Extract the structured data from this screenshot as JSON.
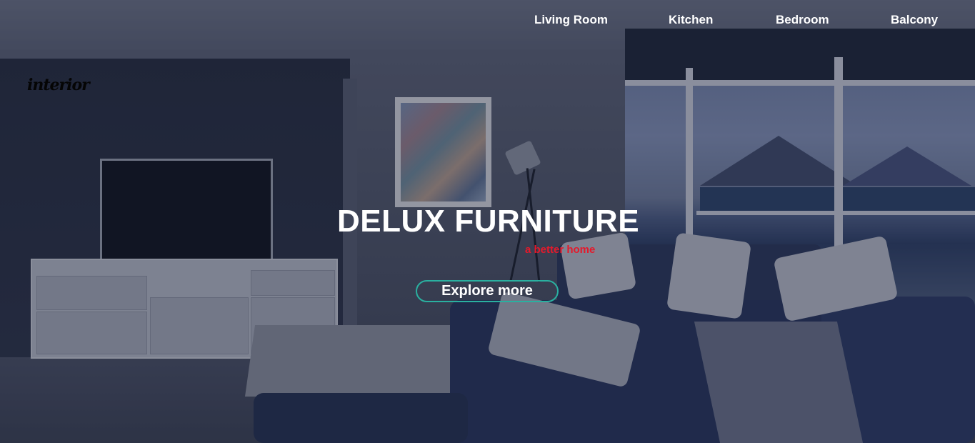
{
  "nav": {
    "items": [
      {
        "label": "Living Room"
      },
      {
        "label": "Kitchen"
      },
      {
        "label": "Bedroom"
      },
      {
        "label": "Balcony"
      }
    ]
  },
  "brand": {
    "logo_text": "interior"
  },
  "hero": {
    "title": "DELUX FURNITURE",
    "subtitle": "a better home",
    "cta_label": "Explore more"
  },
  "colors": {
    "accent_subtitle": "#e5192b",
    "cta_border": "#2ab0a0",
    "text": "#ffffff"
  }
}
